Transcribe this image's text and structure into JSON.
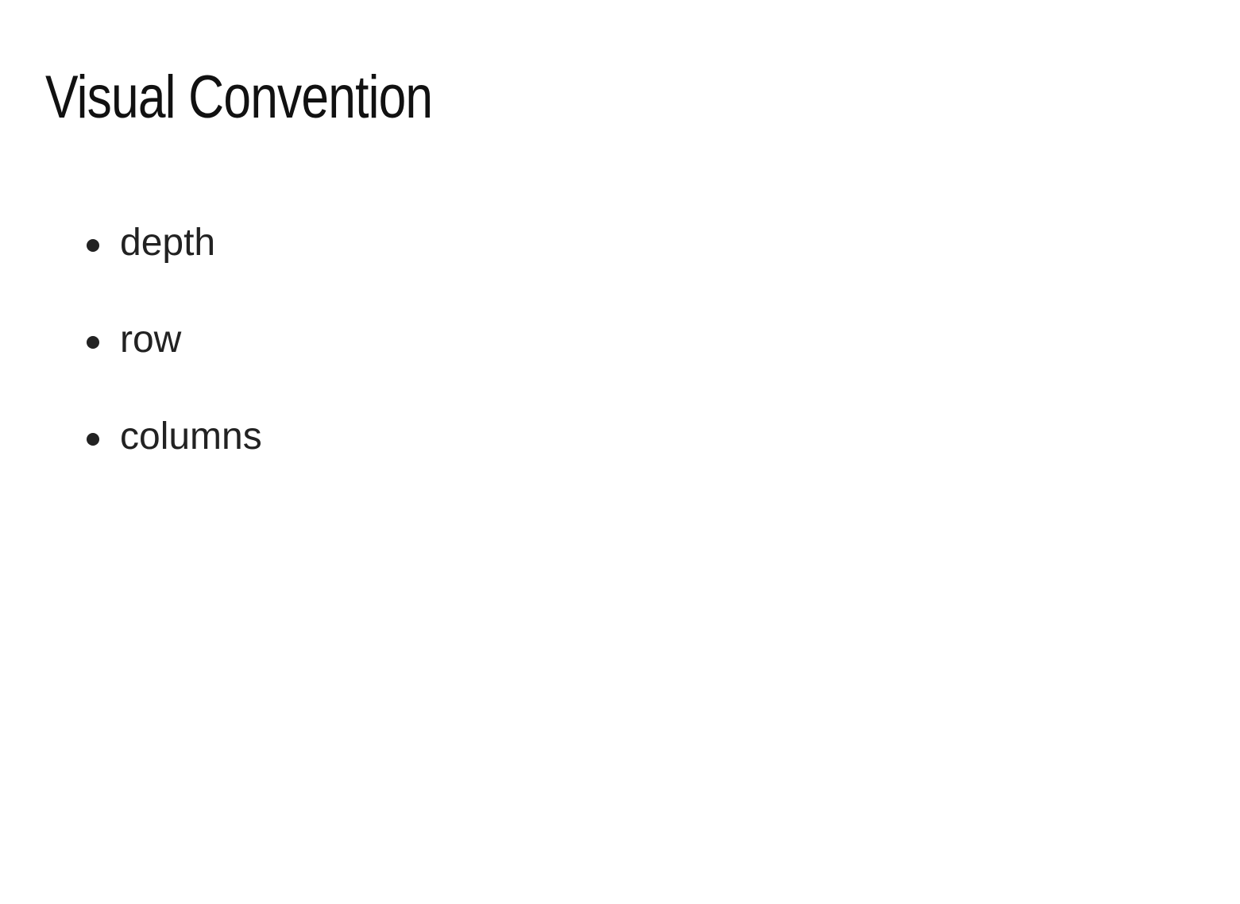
{
  "slide": {
    "title": "Visual Convention",
    "bullets": [
      {
        "label": "depth"
      },
      {
        "label": "row"
      },
      {
        "label": "columns"
      }
    ]
  },
  "colors": {
    "background": "#ffffff",
    "title_text": "#111111",
    "body_text": "#222222"
  }
}
